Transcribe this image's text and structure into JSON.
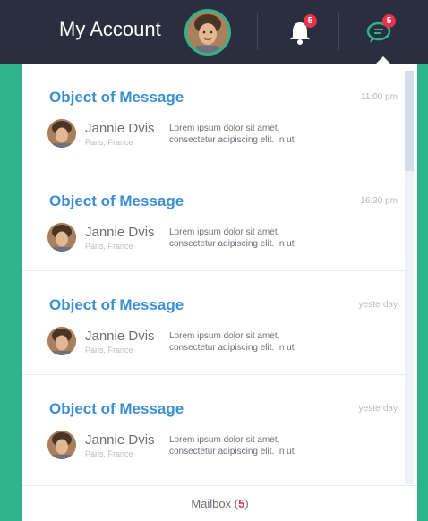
{
  "header": {
    "account_label": "My Account",
    "notifications_count": "5",
    "messages_count": "5"
  },
  "colors": {
    "topbar": "#2b2e3f",
    "accent_green": "#2fb38a",
    "title_blue": "#3b8fd3",
    "badge_red": "#e5344d"
  },
  "icons": {
    "notifications": "bell-icon",
    "messages": "chat-bubble-icon"
  },
  "messages": [
    {
      "title": "Object of Message",
      "time": "11:00 pm",
      "sender": "Jannie Dvis",
      "location": "Paris, France",
      "snippet_line1": "Lorem ipsum dolor sit amet,",
      "snippet_line2": "consectetur adipiscing elit. In ut"
    },
    {
      "title": "Object of Message",
      "time": "16:30 pm",
      "sender": "Jannie Dvis",
      "location": "Paris, France",
      "snippet_line1": "Lorem ipsum dolor sit amet,",
      "snippet_line2": "consectetur adipiscing elit. In ut"
    },
    {
      "title": "Object of Message",
      "time": "yesterday",
      "sender": "Jannie Dvis",
      "location": "Paris, France",
      "snippet_line1": "Lorem ipsum dolor sit amet,",
      "snippet_line2": "consectetur adipiscing elit. In ut"
    },
    {
      "title": "Object of Message",
      "time": "yesterday",
      "sender": "Jannie Dvis",
      "location": "Paris, France",
      "snippet_line1": "Lorem ipsum dolor sit amet,",
      "snippet_line2": "consectetur adipiscing elit. In ut"
    }
  ],
  "footer": {
    "label": "Mailbox",
    "count": "5"
  }
}
